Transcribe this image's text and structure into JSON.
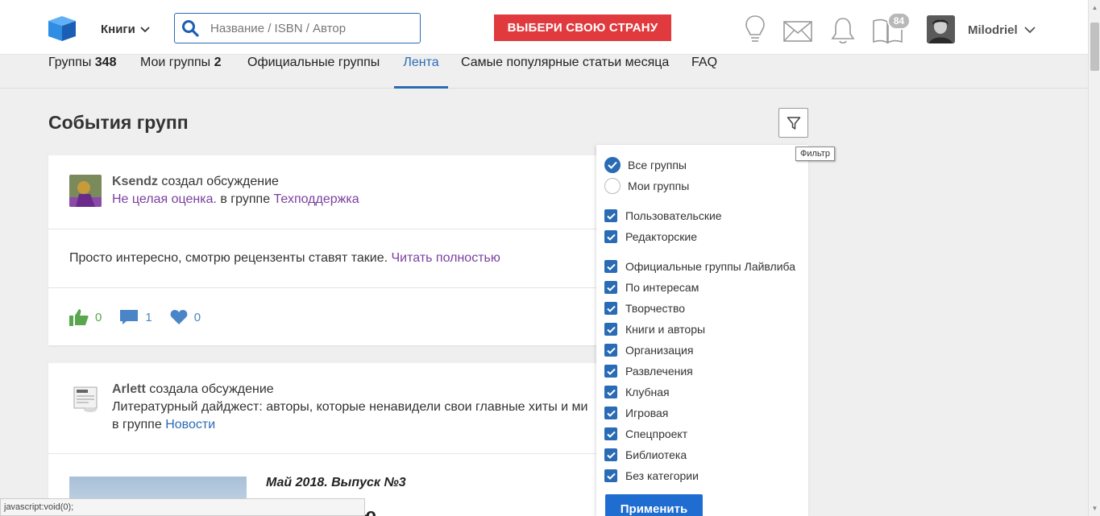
{
  "header": {
    "books_label": "Книги",
    "search_placeholder": "Название / ISBN / Автор",
    "country_button": "ВЫБЕРИ СВОЮ СТРАНУ",
    "notifications_badge": "84",
    "username": "Milodriel"
  },
  "tabs": [
    {
      "label": "Группы",
      "count": "348"
    },
    {
      "label": "Мои группы",
      "count": "2"
    },
    {
      "label": "Официальные группы",
      "count": ""
    },
    {
      "label": "Лента",
      "count": ""
    },
    {
      "label": "Самые популярные статьи месяца",
      "count": ""
    },
    {
      "label": "FAQ",
      "count": ""
    }
  ],
  "page_title": "События групп",
  "filter_tooltip": "Фильтр",
  "feed": [
    {
      "author": "Ksendz",
      "action": "создал обсуждение",
      "topic": "Не целая оценка.",
      "in_group": "в группе",
      "group": "Техподдержка",
      "text": "Просто интересно, смотрю рецензенты ставят такие.",
      "read_more": "Читать полностью",
      "likes": "0",
      "comments": "1",
      "favorites": "0"
    },
    {
      "author": "Arlett",
      "action": "создала обсуждение",
      "topic": "Литературный дайджест: авторы, которые ненавидели свои главные хиты и ми",
      "in_group": "в группе",
      "group": "Новости",
      "issue_title": "Май 2018. Выпуск №3",
      "issue_sub": "ю"
    }
  ],
  "filter": {
    "radios": [
      {
        "label": "Все группы",
        "checked": true
      },
      {
        "label": "Мои группы",
        "checked": false
      }
    ],
    "checkboxes_a": [
      "Пользовательские",
      "Редакторские"
    ],
    "checkboxes_b": [
      "Официальные группы Лайвлиба",
      "По интересам",
      "Творчество",
      "Книги и авторы",
      "Организация",
      "Развлечения",
      "Клубная",
      "Игровая",
      "Спецпроект",
      "Библиотека",
      "Без категории"
    ],
    "apply_label": "Применить"
  },
  "status_bar": "javascript:void(0);",
  "colors": {
    "accent": "#2a6bb5",
    "country": "#e03a3e",
    "visited": "#7b3fa0",
    "like": "#5aa64f",
    "comment": "#4a85c7"
  }
}
